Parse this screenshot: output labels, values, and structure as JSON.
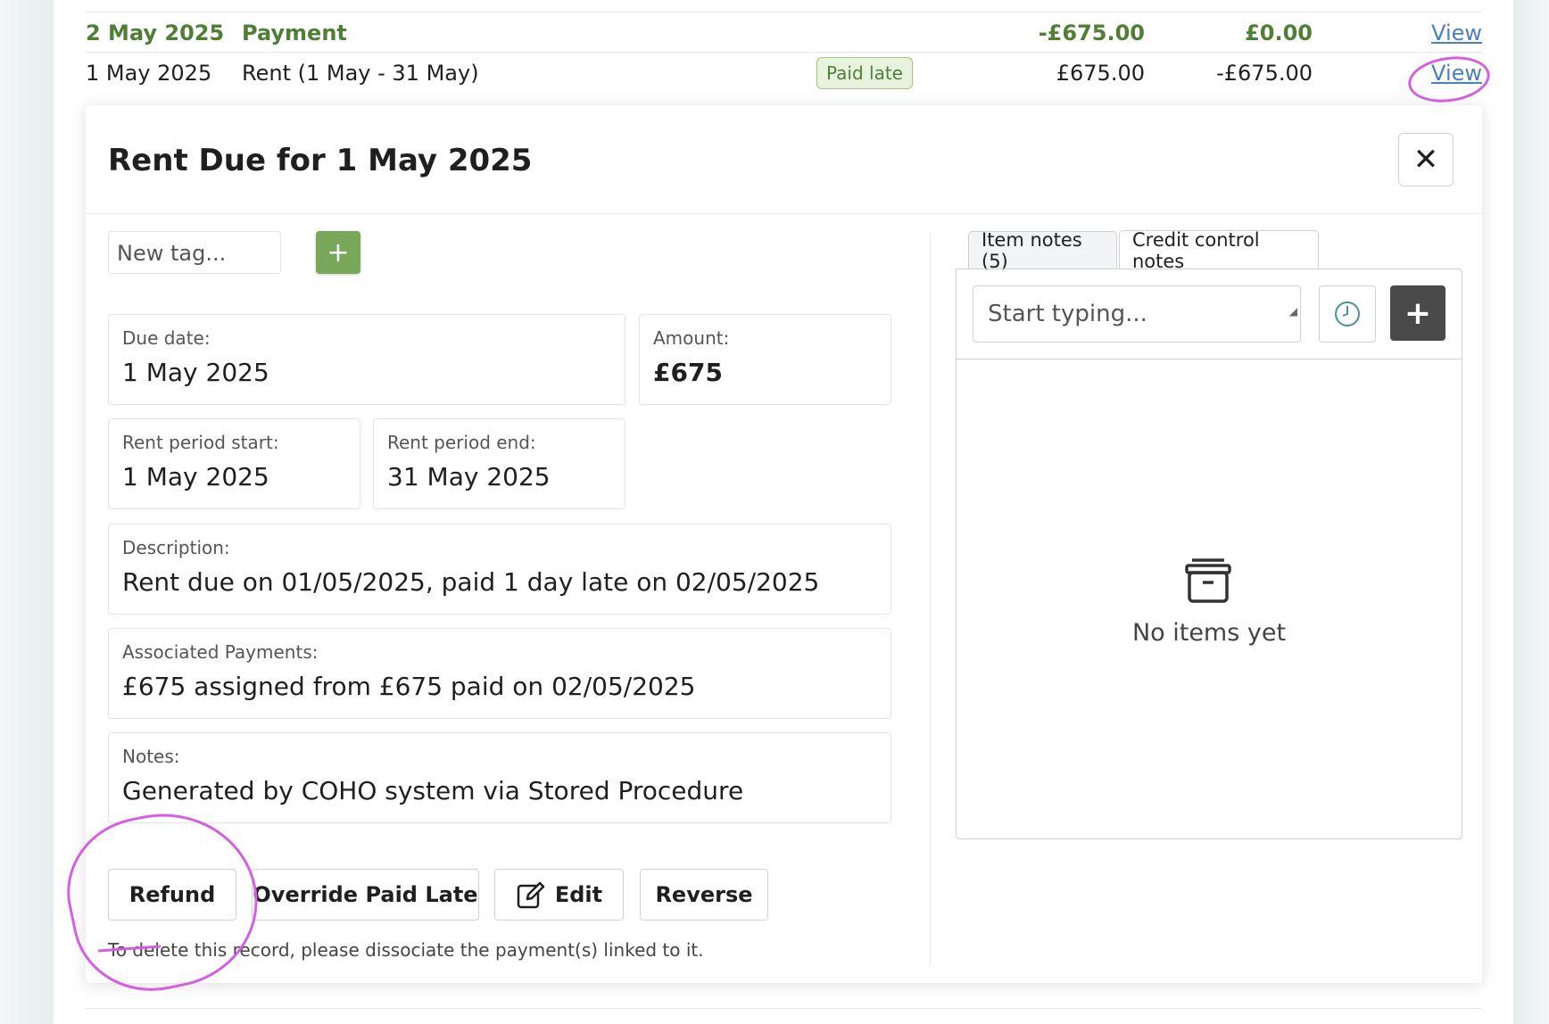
{
  "ledger": {
    "rows": [
      {
        "date": "2 May 2025",
        "description": "Payment",
        "amount": "-£675.00",
        "balance": "£0.00",
        "view": "View"
      },
      {
        "date": "1 May 2025",
        "description": "Rent (1 May - 31 May)",
        "badge": "Paid late",
        "amount": "£675.00",
        "balance": "-£675.00",
        "view": "View"
      }
    ]
  },
  "modal": {
    "title": "Rent Due for 1 May 2025",
    "close_label": "✕",
    "tag_input": {
      "placeholder": "New tag..."
    },
    "tag_add_label": "+",
    "fields": {
      "due_date": {
        "label": "Due date:",
        "value": "1 May 2025"
      },
      "amount": {
        "label": "Amount:",
        "value": "£675"
      },
      "period_start": {
        "label": "Rent period start:",
        "value": "1 May 2025"
      },
      "period_end": {
        "label": "Rent period end:",
        "value": "31 May 2025"
      },
      "description": {
        "label": "Description:",
        "value": "Rent due on 01/05/2025, paid 1 day late on 02/05/2025"
      },
      "associated_payments": {
        "label": "Associated Payments:",
        "value": "£675 assigned from £675 paid on 02/05/2025"
      },
      "notes": {
        "label": "Notes:",
        "value": "Generated by COHO system via Stored Procedure"
      }
    },
    "buttons": {
      "refund": "Refund",
      "override": "Override Paid Late",
      "edit": "Edit",
      "reverse": "Reverse"
    },
    "hint": "To delete this record, please dissociate the payment(s) linked to it.",
    "notes_panel": {
      "tabs": [
        "Item notes (5)",
        "Credit control notes"
      ],
      "active_tab": "Credit control notes",
      "input_placeholder": "Start typing...",
      "add_label": "+",
      "empty_text": "No items yet"
    }
  },
  "colors": {
    "payment_green": "#4f7f35",
    "link_blue": "#4a7fc1",
    "annotation_magenta": "#d55fe0",
    "add_tag_green": "#7aa85a",
    "dark_button": "#4a4a4a"
  },
  "icons": [
    "close-icon",
    "plus-icon",
    "edit-icon",
    "clock-icon",
    "archive-box-icon"
  ]
}
